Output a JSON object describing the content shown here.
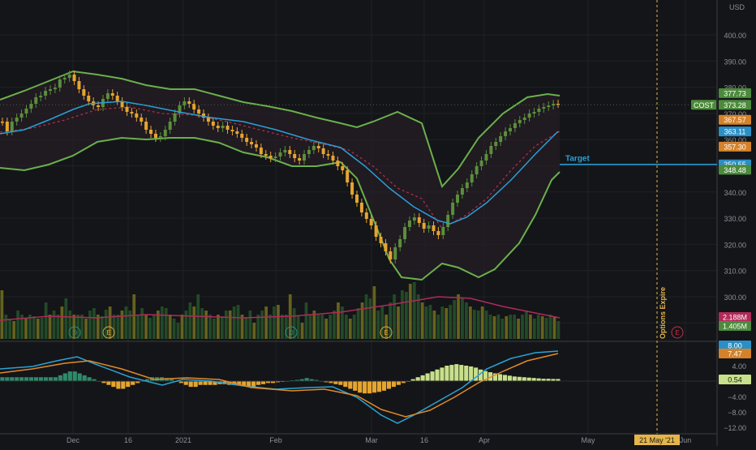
{
  "symbol": "COST",
  "currency": "USD",
  "colors": {
    "background": "#141518",
    "grid": "#1f2126",
    "up_candle": "#5a8f3c",
    "down_candle": "#e5a530",
    "bb_band": "#6ab04c",
    "bb_fill": "#2a1f2a",
    "bb_mid": "#a83244",
    "ema_blue": "#2a9fd6",
    "volume_up": "#24502a",
    "volume_down": "#6e6a1e",
    "volume_ma": "#b02a5a",
    "macd_line": "#2aa3d6",
    "signal_line": "#e08a2a",
    "target": "#2a9fd6",
    "expiry": "#e5b54a",
    "axis_text": "#8b9098"
  },
  "price_axis": {
    "ticks": [
      "400.00",
      "390.00",
      "380.00",
      "370.00",
      "360.00",
      "350.00",
      "340.00",
      "330.00",
      "320.00",
      "310.00",
      "300.00"
    ],
    "tick_values": [
      400,
      390,
      380,
      370,
      360,
      350,
      340,
      330,
      320,
      310,
      300
    ]
  },
  "price_labels": [
    {
      "text": "COST",
      "value": "373.28",
      "color": "#4c8a3c",
      "price": 373.28
    },
    {
      "value": "377.73",
      "color": "#4c8a3c",
      "price": 377.73
    },
    {
      "value": "367.57",
      "color": "#d4822a",
      "price": 367.57
    },
    {
      "value": "363.11",
      "color": "#2a8fc6",
      "price": 363.11
    },
    {
      "value": "357.30",
      "color": "#d4822a",
      "price": 357.3
    },
    {
      "value": "350.55",
      "color": "#2a8fc6",
      "price": 350.55
    },
    {
      "value": "348.48",
      "color": "#4c8a3c",
      "price": 348.48
    }
  ],
  "volume_labels": [
    {
      "value": "2.188M",
      "color": "#b02a5a"
    },
    {
      "value": "1.405M",
      "color": "#4c8a3c"
    }
  ],
  "macd_axis": {
    "ticks": [
      "4.00",
      "−4.00",
      "−8.00",
      "−12.00"
    ],
    "tick_values": [
      4,
      -4,
      -8,
      -12
    ]
  },
  "macd_labels": [
    {
      "value": "8.00",
      "color": "#2a8fc6"
    },
    {
      "value": "7.47",
      "color": "#d4822a"
    },
    {
      "value": "0.54",
      "color": "#c8e08a"
    }
  ],
  "time_axis": [
    "Dec",
    "16",
    "2021",
    "Feb",
    "Mar",
    "16",
    "Apr",
    "May",
    "Jun"
  ],
  "expiry_date_label": "21 May '21",
  "target_label": "Target",
  "expiry_label": "Options Expire",
  "event_markers": [
    "D",
    "E",
    "D",
    "E",
    "E"
  ],
  "chart_data": {
    "type": "line",
    "x": [
      "Dec",
      "16",
      "2021",
      "Feb",
      "Mar",
      "16",
      "Apr",
      "May",
      "Jun"
    ],
    "target": 350.55,
    "last": 373.28
  }
}
